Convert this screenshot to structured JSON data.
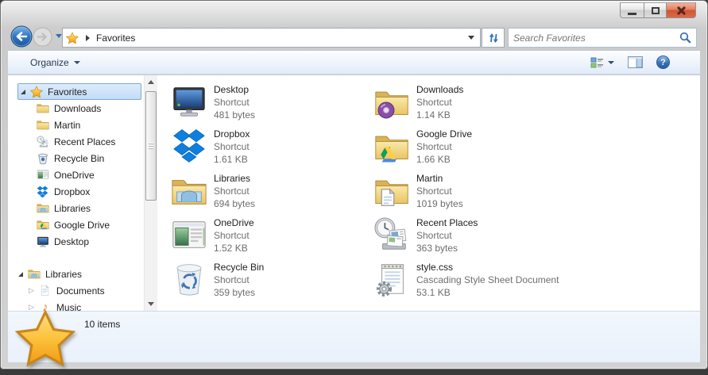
{
  "navigation": {
    "breadcrumb_location": "Favorites",
    "search_placeholder": "Search Favorites"
  },
  "toolbar": {
    "organize_label": "Organize"
  },
  "sidebar": {
    "items": [
      {
        "label": "Favorites",
        "selected": true
      },
      {
        "label": "Downloads"
      },
      {
        "label": "Martin"
      },
      {
        "label": "Recent Places"
      },
      {
        "label": "Recycle Bin"
      },
      {
        "label": "OneDrive"
      },
      {
        "label": "Dropbox"
      },
      {
        "label": "Libraries"
      },
      {
        "label": "Google Drive"
      },
      {
        "label": "Desktop"
      },
      {
        "label": "Libraries",
        "section": true
      },
      {
        "label": "Documents"
      },
      {
        "label": "Music"
      }
    ]
  },
  "files": [
    {
      "name": "Desktop",
      "type": "Shortcut",
      "size": "481 bytes"
    },
    {
      "name": "Downloads",
      "type": "Shortcut",
      "size": "1.14 KB"
    },
    {
      "name": "Dropbox",
      "type": "Shortcut",
      "size": "1.61 KB"
    },
    {
      "name": "Google Drive",
      "type": "Shortcut",
      "size": "1.66 KB"
    },
    {
      "name": "Libraries",
      "type": "Shortcut",
      "size": "694 bytes"
    },
    {
      "name": "Martin",
      "type": "Shortcut",
      "size": "1019 bytes"
    },
    {
      "name": "OneDrive",
      "type": "Shortcut",
      "size": "1.52 KB"
    },
    {
      "name": "Recent Places",
      "type": "Shortcut",
      "size": "363 bytes"
    },
    {
      "name": "Recycle Bin",
      "type": "Shortcut",
      "size": "359 bytes"
    },
    {
      "name": "style.css",
      "type": "Cascading Style Sheet Document",
      "size": "53.1 KB"
    }
  ],
  "statusbar": {
    "items_count": "10 items"
  },
  "colors": {
    "selection_fill": "#c2dcf6",
    "selection_border": "#7fa8d4",
    "close_button": "#d96a4a",
    "details_pane": "#e9f1fb",
    "dropbox_blue": "#0d7fe0",
    "folder_yellow": "#efd279"
  }
}
